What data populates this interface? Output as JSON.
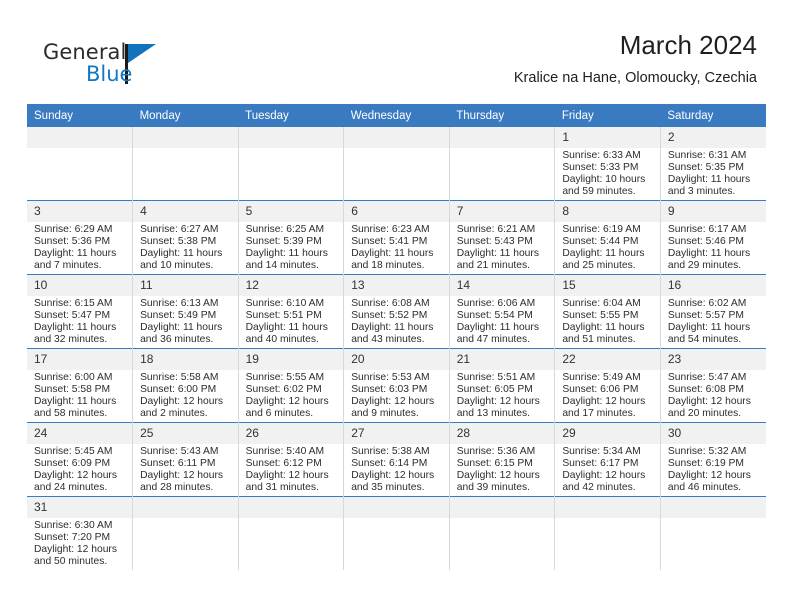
{
  "brand": {
    "name_part1": "General",
    "name_part2": "Blue",
    "logo_icon": "triangle-flag-icon"
  },
  "header": {
    "title": "March 2024",
    "subtitle": "Kralice na Hane, Olomoucky, Czechia"
  },
  "colors": {
    "header_blue": "#3a7ac0",
    "brand_blue": "#1277c4",
    "daynum_gray": "#f1f1f1",
    "cell_border": "#d8d8d8"
  },
  "weekday_headers": [
    "Sunday",
    "Monday",
    "Tuesday",
    "Wednesday",
    "Thursday",
    "Friday",
    "Saturday"
  ],
  "weeks": [
    [
      {
        "day": "",
        "lines": [
          "",
          "",
          "",
          ""
        ]
      },
      {
        "day": "",
        "lines": [
          "",
          "",
          "",
          ""
        ]
      },
      {
        "day": "",
        "lines": [
          "",
          "",
          "",
          ""
        ]
      },
      {
        "day": "",
        "lines": [
          "",
          "",
          "",
          ""
        ]
      },
      {
        "day": "",
        "lines": [
          "",
          "",
          "",
          ""
        ]
      },
      {
        "day": "1",
        "lines": [
          "Sunrise: 6:33 AM",
          "Sunset: 5:33 PM",
          "Daylight: 10 hours",
          "and 59 minutes."
        ]
      },
      {
        "day": "2",
        "lines": [
          "Sunrise: 6:31 AM",
          "Sunset: 5:35 PM",
          "Daylight: 11 hours",
          "and 3 minutes."
        ]
      }
    ],
    [
      {
        "day": "3",
        "lines": [
          "Sunrise: 6:29 AM",
          "Sunset: 5:36 PM",
          "Daylight: 11 hours",
          "and 7 minutes."
        ]
      },
      {
        "day": "4",
        "lines": [
          "Sunrise: 6:27 AM",
          "Sunset: 5:38 PM",
          "Daylight: 11 hours",
          "and 10 minutes."
        ]
      },
      {
        "day": "5",
        "lines": [
          "Sunrise: 6:25 AM",
          "Sunset: 5:39 PM",
          "Daylight: 11 hours",
          "and 14 minutes."
        ]
      },
      {
        "day": "6",
        "lines": [
          "Sunrise: 6:23 AM",
          "Sunset: 5:41 PM",
          "Daylight: 11 hours",
          "and 18 minutes."
        ]
      },
      {
        "day": "7",
        "lines": [
          "Sunrise: 6:21 AM",
          "Sunset: 5:43 PM",
          "Daylight: 11 hours",
          "and 21 minutes."
        ]
      },
      {
        "day": "8",
        "lines": [
          "Sunrise: 6:19 AM",
          "Sunset: 5:44 PM",
          "Daylight: 11 hours",
          "and 25 minutes."
        ]
      },
      {
        "day": "9",
        "lines": [
          "Sunrise: 6:17 AM",
          "Sunset: 5:46 PM",
          "Daylight: 11 hours",
          "and 29 minutes."
        ]
      }
    ],
    [
      {
        "day": "10",
        "lines": [
          "Sunrise: 6:15 AM",
          "Sunset: 5:47 PM",
          "Daylight: 11 hours",
          "and 32 minutes."
        ]
      },
      {
        "day": "11",
        "lines": [
          "Sunrise: 6:13 AM",
          "Sunset: 5:49 PM",
          "Daylight: 11 hours",
          "and 36 minutes."
        ]
      },
      {
        "day": "12",
        "lines": [
          "Sunrise: 6:10 AM",
          "Sunset: 5:51 PM",
          "Daylight: 11 hours",
          "and 40 minutes."
        ]
      },
      {
        "day": "13",
        "lines": [
          "Sunrise: 6:08 AM",
          "Sunset: 5:52 PM",
          "Daylight: 11 hours",
          "and 43 minutes."
        ]
      },
      {
        "day": "14",
        "lines": [
          "Sunrise: 6:06 AM",
          "Sunset: 5:54 PM",
          "Daylight: 11 hours",
          "and 47 minutes."
        ]
      },
      {
        "day": "15",
        "lines": [
          "Sunrise: 6:04 AM",
          "Sunset: 5:55 PM",
          "Daylight: 11 hours",
          "and 51 minutes."
        ]
      },
      {
        "day": "16",
        "lines": [
          "Sunrise: 6:02 AM",
          "Sunset: 5:57 PM",
          "Daylight: 11 hours",
          "and 54 minutes."
        ]
      }
    ],
    [
      {
        "day": "17",
        "lines": [
          "Sunrise: 6:00 AM",
          "Sunset: 5:58 PM",
          "Daylight: 11 hours",
          "and 58 minutes."
        ]
      },
      {
        "day": "18",
        "lines": [
          "Sunrise: 5:58 AM",
          "Sunset: 6:00 PM",
          "Daylight: 12 hours",
          "and 2 minutes."
        ]
      },
      {
        "day": "19",
        "lines": [
          "Sunrise: 5:55 AM",
          "Sunset: 6:02 PM",
          "Daylight: 12 hours",
          "and 6 minutes."
        ]
      },
      {
        "day": "20",
        "lines": [
          "Sunrise: 5:53 AM",
          "Sunset: 6:03 PM",
          "Daylight: 12 hours",
          "and 9 minutes."
        ]
      },
      {
        "day": "21",
        "lines": [
          "Sunrise: 5:51 AM",
          "Sunset: 6:05 PM",
          "Daylight: 12 hours",
          "and 13 minutes."
        ]
      },
      {
        "day": "22",
        "lines": [
          "Sunrise: 5:49 AM",
          "Sunset: 6:06 PM",
          "Daylight: 12 hours",
          "and 17 minutes."
        ]
      },
      {
        "day": "23",
        "lines": [
          "Sunrise: 5:47 AM",
          "Sunset: 6:08 PM",
          "Daylight: 12 hours",
          "and 20 minutes."
        ]
      }
    ],
    [
      {
        "day": "24",
        "lines": [
          "Sunrise: 5:45 AM",
          "Sunset: 6:09 PM",
          "Daylight: 12 hours",
          "and 24 minutes."
        ]
      },
      {
        "day": "25",
        "lines": [
          "Sunrise: 5:43 AM",
          "Sunset: 6:11 PM",
          "Daylight: 12 hours",
          "and 28 minutes."
        ]
      },
      {
        "day": "26",
        "lines": [
          "Sunrise: 5:40 AM",
          "Sunset: 6:12 PM",
          "Daylight: 12 hours",
          "and 31 minutes."
        ]
      },
      {
        "day": "27",
        "lines": [
          "Sunrise: 5:38 AM",
          "Sunset: 6:14 PM",
          "Daylight: 12 hours",
          "and 35 minutes."
        ]
      },
      {
        "day": "28",
        "lines": [
          "Sunrise: 5:36 AM",
          "Sunset: 6:15 PM",
          "Daylight: 12 hours",
          "and 39 minutes."
        ]
      },
      {
        "day": "29",
        "lines": [
          "Sunrise: 5:34 AM",
          "Sunset: 6:17 PM",
          "Daylight: 12 hours",
          "and 42 minutes."
        ]
      },
      {
        "day": "30",
        "lines": [
          "Sunrise: 5:32 AM",
          "Sunset: 6:19 PM",
          "Daylight: 12 hours",
          "and 46 minutes."
        ]
      }
    ],
    [
      {
        "day": "31",
        "lines": [
          "Sunrise: 6:30 AM",
          "Sunset: 7:20 PM",
          "Daylight: 12 hours",
          "and 50 minutes."
        ]
      },
      {
        "day": "",
        "lines": [
          "",
          "",
          "",
          ""
        ]
      },
      {
        "day": "",
        "lines": [
          "",
          "",
          "",
          ""
        ]
      },
      {
        "day": "",
        "lines": [
          "",
          "",
          "",
          ""
        ]
      },
      {
        "day": "",
        "lines": [
          "",
          "",
          "",
          ""
        ]
      },
      {
        "day": "",
        "lines": [
          "",
          "",
          "",
          ""
        ]
      },
      {
        "day": "",
        "lines": [
          "",
          "",
          "",
          ""
        ]
      }
    ]
  ]
}
